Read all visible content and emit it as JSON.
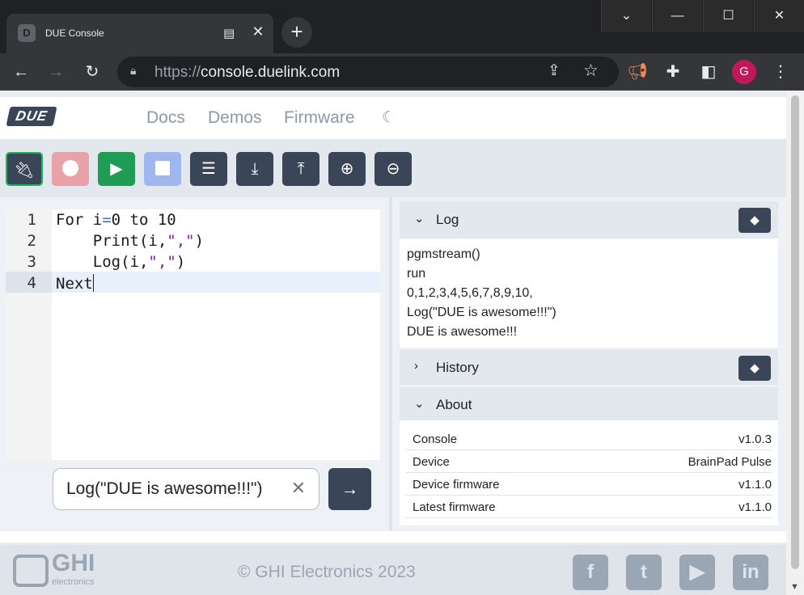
{
  "browser": {
    "tab_title": "DUE Console",
    "favicon_text": "D",
    "url_scheme": "https://",
    "url_host": "console.duelink.com",
    "avatar_letter": "G"
  },
  "nav": {
    "logo": "DUE",
    "links": [
      "Docs",
      "Demos",
      "Firmware"
    ]
  },
  "editor": {
    "line_numbers": [
      "1",
      "2",
      "3",
      "4"
    ],
    "line1_kw": "For i",
    "line1_eq": "=",
    "line1_num": "0",
    "line1_rest": " to 10",
    "line2_pre": "    Print(i,",
    "line2_str": "\",\"",
    "line2_post": ")",
    "line3_pre": "    Log(i,",
    "line3_str": "\",\"",
    "line3_post": ")",
    "line4": "Next"
  },
  "command": {
    "value": "Log(\"DUE is awesome!!!\")",
    "clear_symbol": "✕",
    "send_symbol": "→"
  },
  "panels": {
    "log": {
      "label": "Log",
      "lines": [
        "pgmstream()",
        "run",
        "0,1,2,3,4,5,6,7,8,9,10,",
        "Log(\"DUE is awesome!!!\")",
        "DUE is awesome!!!"
      ]
    },
    "history": {
      "label": "History"
    },
    "about": {
      "label": "About",
      "rows": [
        {
          "key": "Console",
          "value": "v1.0.3"
        },
        {
          "key": "Device",
          "value": "BrainPad Pulse"
        },
        {
          "key": "Device firmware",
          "value": "v1.1.0"
        },
        {
          "key": "Latest firmware",
          "value": "v1.1.0"
        }
      ]
    }
  },
  "footer": {
    "brand": "GHI",
    "brand_sub": "electronics",
    "copyright": "© GHI Electronics 2023",
    "social": [
      "f",
      "t",
      "▶",
      "in"
    ]
  },
  "colors": {
    "connect": "#3a4657",
    "record": "#e8a2a8",
    "run": "#1f9d55",
    "stop": "#9fb7ee",
    "dark_button": "#3a4657"
  },
  "icons": {
    "toolbar": [
      "plug-disconnect-icon",
      "record-icon",
      "play-icon",
      "stop-icon",
      "list-icon",
      "download-icon",
      "upload-icon",
      "zoom-in-icon",
      "zoom-out-icon"
    ]
  }
}
